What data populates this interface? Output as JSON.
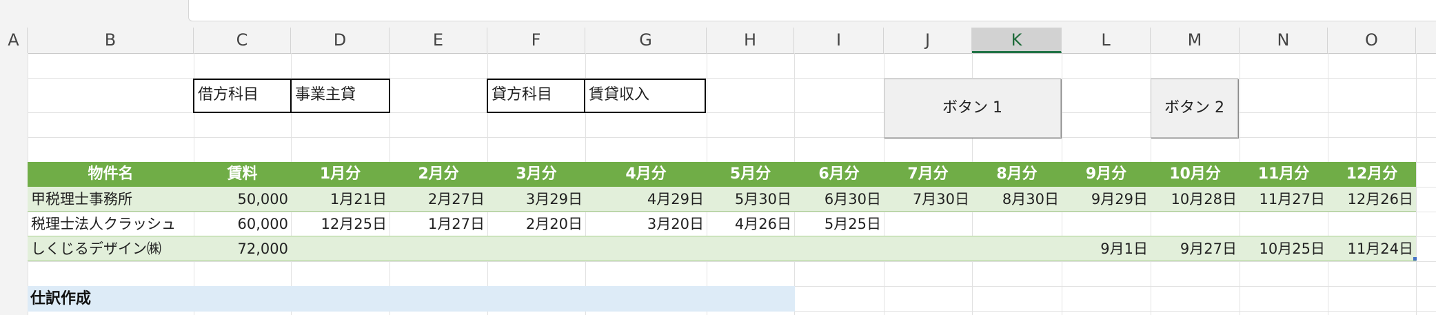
{
  "columns": [
    "A",
    "B",
    "C",
    "D",
    "E",
    "F",
    "G",
    "H",
    "I",
    "J",
    "K",
    "L",
    "M",
    "N",
    "O"
  ],
  "selected_column": "K",
  "settings": {
    "debit_label": "借方科目",
    "debit_value": "事業主貸",
    "credit_label": "貸方科目",
    "credit_value": "賃貸収入"
  },
  "buttons": {
    "button1": "ボタン 1",
    "button2": "ボタン 2"
  },
  "table": {
    "headers": [
      "物件名",
      "賃料",
      "1月分",
      "2月分",
      "3月分",
      "4月分",
      "5月分",
      "6月分",
      "7月分",
      "8月分",
      "9月分",
      "10月分",
      "11月分",
      "12月分"
    ],
    "rows": [
      [
        "甲税理士事務所",
        "50,000",
        "1月21日",
        "2月27日",
        "3月29日",
        "4月29日",
        "5月30日",
        "6月30日",
        "7月30日",
        "8月30日",
        "9月29日",
        "10月28日",
        "11月27日",
        "12月26日"
      ],
      [
        "税理士法人クラッシュ",
        "60,000",
        "12月25日",
        "1月27日",
        "2月20日",
        "3月20日",
        "4月26日",
        "5月25日",
        "",
        "",
        "",
        "",
        "",
        ""
      ],
      [
        "しくじるデザイン㈱",
        "72,000",
        "",
        "",
        "",
        "",
        "",
        "",
        "",
        "",
        "9月1日",
        "9月27日",
        "10月25日",
        "11月24日"
      ]
    ]
  },
  "section": {
    "journal_title": "仕訳作成"
  },
  "colors": {
    "table_header": "#70ad47",
    "band": "#e2efda",
    "section_bg": "#ddebf7",
    "selected_header": "#217346"
  }
}
